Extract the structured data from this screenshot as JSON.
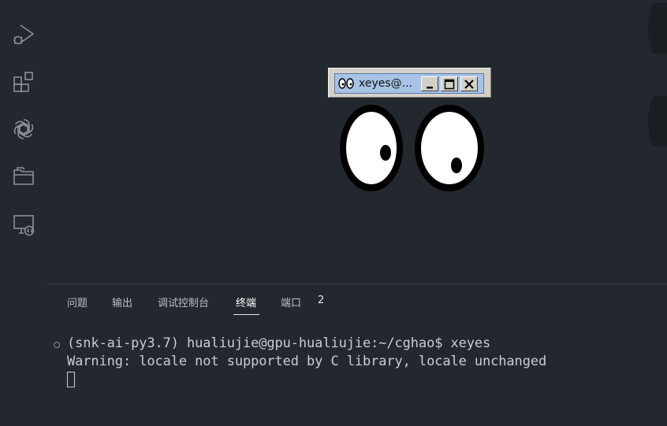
{
  "activity_bar": {
    "icons": [
      "run-debug-icon",
      "extensions-icon",
      "openai-icon",
      "folder-icon",
      "remote-explorer-icon"
    ]
  },
  "xeyes_window": {
    "title": "xeyes@...",
    "buttons": [
      "minimize-icon",
      "maximize-icon",
      "close-icon"
    ]
  },
  "panel": {
    "tabs": [
      {
        "label": "问题",
        "active": false
      },
      {
        "label": "输出",
        "active": false
      },
      {
        "label": "调试控制台",
        "active": false
      },
      {
        "label": "终端",
        "active": true
      },
      {
        "label": "端口",
        "active": false
      }
    ],
    "ports_badge": "2"
  },
  "terminal": {
    "line1": "(snk-ai-py3.7) hualiujie@gpu-hualiujie:~/cghao$ xeyes",
    "line2": "Warning: locale not supported by C library, locale unchanged"
  },
  "colors": {
    "background": "#23272e",
    "text": "#c9cdd3",
    "xeyes_title_bg": "#a7c3e6"
  }
}
